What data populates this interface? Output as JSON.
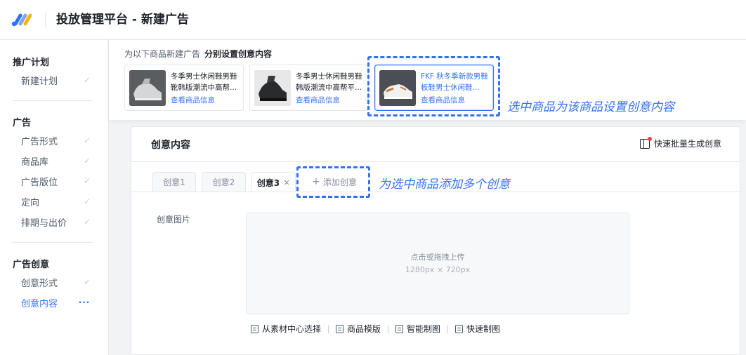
{
  "header": {
    "title": "投放管理平台 - 新建广告"
  },
  "sidebar": {
    "groups": [
      {
        "label": "推广计划",
        "items": [
          {
            "label": "新建计划",
            "mark": "✓"
          }
        ]
      },
      {
        "label": "广告",
        "items": [
          {
            "label": "广告形式",
            "mark": "✓"
          },
          {
            "label": "商品库",
            "mark": "✓"
          },
          {
            "label": "广告版位",
            "mark": "✓"
          },
          {
            "label": "定向",
            "mark": "✓"
          },
          {
            "label": "排期与出价",
            "mark": "✓"
          }
        ]
      },
      {
        "label": "广告创意",
        "items": [
          {
            "label": "创意形式",
            "mark": "✓"
          },
          {
            "label": "创意内容",
            "mark": "···"
          }
        ]
      }
    ]
  },
  "strip": {
    "title": "为以下商品新建广告",
    "title_strong": "分别设置创意内容",
    "products": [
      {
        "name": "冬季男士休闲鞋男鞋靴韩版潮流中高帮...",
        "link": "查看商品信息"
      },
      {
        "name": "冬季男士休闲鞋男鞋韩版潮流中高帮平...",
        "link": "查看商品信息"
      },
      {
        "name": "FKF 秋冬季新款男鞋板鞋男士休闲鞋...",
        "link": "查看商品信息"
      }
    ],
    "annotation": "选中商品为该商品设置创意内容"
  },
  "content": {
    "title": "创意内容",
    "quick_gen": "快速批量生成创意",
    "tabs": [
      {
        "label": "创意1"
      },
      {
        "label": "创意2"
      },
      {
        "label": "创意3",
        "close": "×"
      }
    ],
    "add_tab": "添加创意",
    "add_plus": "+",
    "annotation": "为选中商品添加多个创意",
    "field_label": "创意图片",
    "upload_main": "点击或拖拽上传",
    "upload_sub": "1280px × 720px",
    "tools": [
      "从素材中心选择",
      "商品模版",
      "智能制图",
      "快速制图"
    ]
  },
  "colors": {
    "accent": "#3370ff",
    "border": "#e5e6eb",
    "muted": "#86909c"
  }
}
